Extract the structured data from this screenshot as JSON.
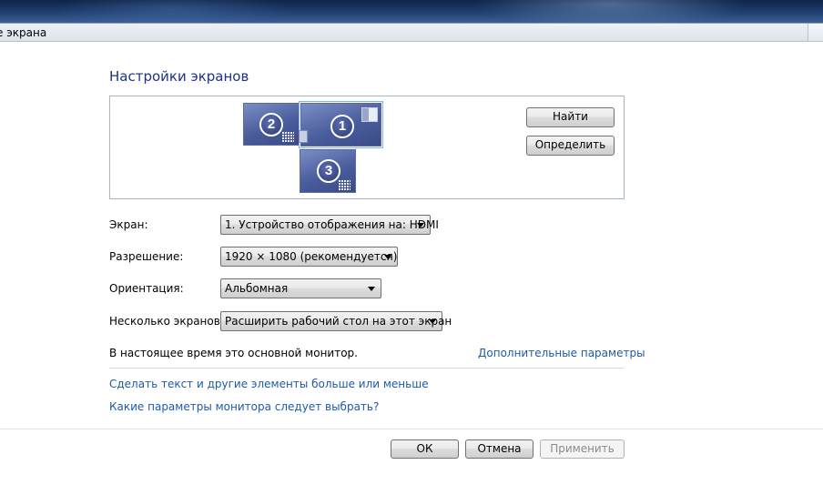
{
  "window": {
    "address_text": "е экрана"
  },
  "page": {
    "title": "Настройки экранов"
  },
  "monitors": [
    {
      "number": "2",
      "selected": false
    },
    {
      "number": "1",
      "selected": true
    },
    {
      "number": "3",
      "selected": false
    }
  ],
  "panel_buttons": {
    "find": "Найти",
    "identify": "Определить"
  },
  "settings": {
    "display": {
      "label": "Экран:",
      "value": "1. Устройство отображения на: HDMI"
    },
    "resolution": {
      "label": "Разрешение:",
      "value": "1920 × 1080 (рекомендуется)"
    },
    "orientation": {
      "label": "Ориентация:",
      "value": "Альбомная"
    },
    "multiple": {
      "label": "Несколько экранов:",
      "value": "Расширить рабочий стол на этот экран"
    }
  },
  "status": {
    "text": "В настоящее время это основной монитор.",
    "advanced_link": "Дополнительные параметры"
  },
  "links": {
    "text_size": "Сделать текст и другие элементы больше или меньше",
    "which_settings": "Какие параметры монитора следует выбрать?"
  },
  "buttons": {
    "ok": "ОК",
    "cancel": "Отмена",
    "apply": "Применить"
  },
  "colors": {
    "link": "#1e5aa8",
    "title": "#1e3287",
    "monitor": "#4a5d9c"
  }
}
